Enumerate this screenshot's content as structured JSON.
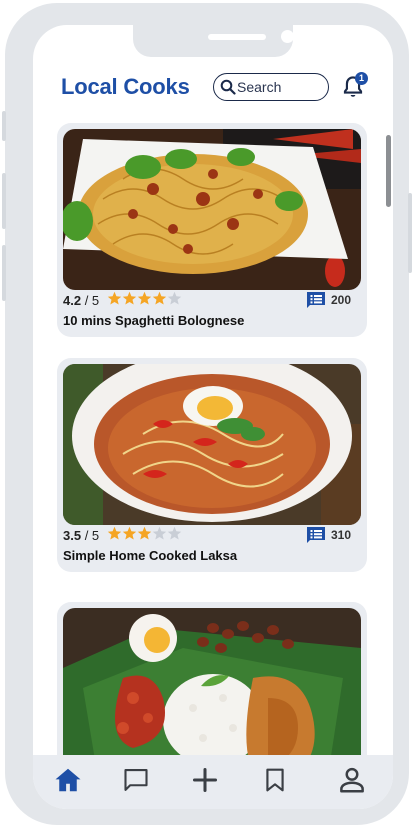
{
  "app": {
    "title": "Local Cooks"
  },
  "search": {
    "placeholder": "Search"
  },
  "notifications": {
    "count": "1"
  },
  "colors": {
    "brand": "#1e4fa6",
    "star": "#f5a524",
    "star_empty": "#c9ced6",
    "card_bg": "#e9ecf1",
    "frame": "#e3e6ea"
  },
  "recipes": [
    {
      "rating": "4.2",
      "scale": "/ 5",
      "stars_filled": 4,
      "comments": "200",
      "title": "10 mins Spaghetti Bolognese",
      "image_icon": "spaghetti-photo"
    },
    {
      "rating": "3.5",
      "scale": "/ 5",
      "stars_filled": 3,
      "comments": "310",
      "title": "Simple Home Cooked Laksa",
      "image_icon": "laksa-photo"
    },
    {
      "image_icon": "nasi-lemak-photo"
    }
  ],
  "nav": {
    "items": [
      {
        "icon": "home-icon",
        "active": true
      },
      {
        "icon": "chat-icon",
        "active": false
      },
      {
        "icon": "plus-icon",
        "active": false
      },
      {
        "icon": "bookmark-icon",
        "active": false
      },
      {
        "icon": "profile-icon",
        "active": false
      }
    ]
  }
}
